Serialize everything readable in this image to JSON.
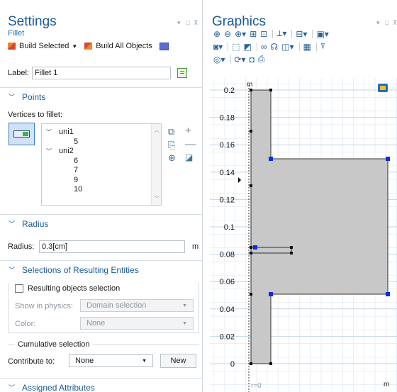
{
  "settings": {
    "title": "Settings",
    "subtitle": "Fillet",
    "build_selected": "Build Selected",
    "build_all": "Build All Objects",
    "label_prefix": "Label:",
    "label_value": "Fillet 1",
    "points": {
      "header": "Points",
      "vertices_label": "Vertices to fillet:",
      "tree": [
        {
          "text": "uni1",
          "type": "group"
        },
        {
          "text": "5",
          "type": "leaf"
        },
        {
          "text": "uni2",
          "type": "group"
        },
        {
          "text": "6",
          "type": "leaf"
        },
        {
          "text": "7",
          "type": "leaf"
        },
        {
          "text": "9",
          "type": "leaf"
        },
        {
          "text": "10",
          "type": "leaf"
        }
      ]
    },
    "radius": {
      "header": "Radius",
      "label": "Radius:",
      "value": "0.3[cm]",
      "unit": "m"
    },
    "selections": {
      "header": "Selections of Resulting Entities",
      "resulting_label": "Resulting objects selection",
      "show_in_physics_label": "Show in physics:",
      "show_in_physics_value": "Domain selection",
      "color_label": "Color:",
      "color_value": "None",
      "cumulative_label": "Cumulative selection",
      "contribute_label": "Contribute to:",
      "contribute_value": "None",
      "new_button": "New"
    },
    "assigned": {
      "header": "Assigned Attributes"
    }
  },
  "graphics": {
    "title": "Graphics",
    "axis_unit_top": "m",
    "axis_unit_bottom": "m",
    "r_label": "r=0",
    "y_ticks": [
      "0.2",
      "0.18",
      "0.16",
      "0.14",
      "0.12",
      "0.1",
      "0.08",
      "0.06",
      "0.04",
      "0.02",
      "0"
    ]
  },
  "colors": {
    "accent": "#1b5a96",
    "link": "#1b6fb5",
    "geometry_fill": "#c8c8c8",
    "selected_vertex": "#0a2be8",
    "grid": "#dce7f2"
  }
}
